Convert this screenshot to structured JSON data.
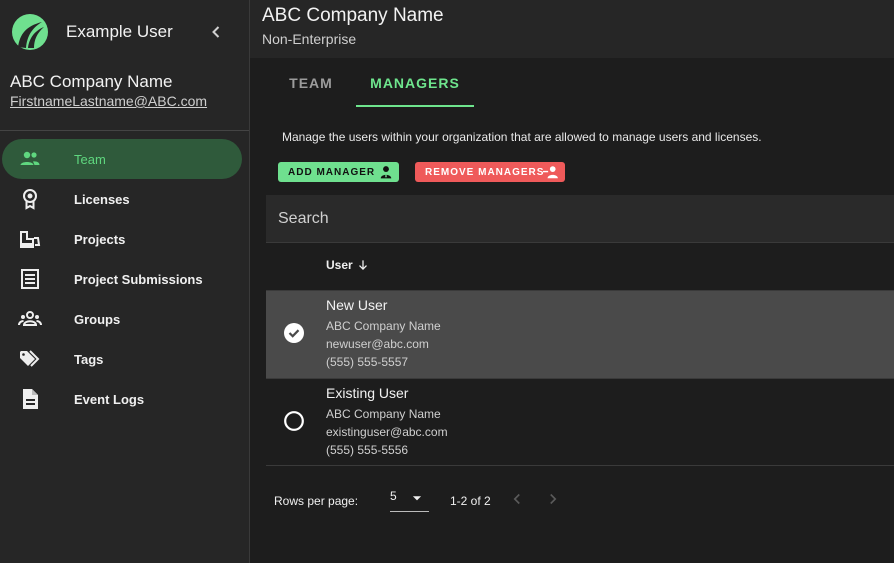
{
  "sidebar": {
    "user_name": "Example User",
    "company": "ABC Company Name",
    "email": "FirstnameLastname@ABC.com",
    "items": [
      {
        "label": "Team",
        "icon": "people-icon",
        "active": true
      },
      {
        "label": "Licenses",
        "icon": "license-badge-icon"
      },
      {
        "label": "Projects",
        "icon": "bulldozer-icon"
      },
      {
        "label": "Project Submissions",
        "icon": "document-list-icon"
      },
      {
        "label": "Groups",
        "icon": "groups-icon"
      },
      {
        "label": "Tags",
        "icon": "tags-icon"
      },
      {
        "label": "Event Logs",
        "icon": "file-icon"
      }
    ]
  },
  "header": {
    "title": "ABC Company Name",
    "subtitle": "Non-Enterprise"
  },
  "tabs": [
    {
      "label": "TEAM"
    },
    {
      "label": "MANAGERS",
      "active": true
    }
  ],
  "description": "Manage the users within your organization that are allowed to manage users and licenses.",
  "buttons": {
    "add": "ADD MANAGER",
    "remove": "REMOVE MANAGERS"
  },
  "search": {
    "placeholder": "Search"
  },
  "table": {
    "column": "User",
    "rows": [
      {
        "name": "New User",
        "company": "ABC Company Name",
        "email": "newuser@abc.com",
        "phone": "(555) 555-5557",
        "selected": true
      },
      {
        "name": "Existing User",
        "company": "ABC Company Name",
        "email": "existinguser@abc.com",
        "phone": "(555) 555-5556",
        "selected": false
      }
    ]
  },
  "pagination": {
    "rows_label": "Rows per page:",
    "rows_value": "5",
    "range": "1-2 of 2"
  },
  "colors": {
    "accent_green": "#6ee58d",
    "remove_red": "#ef5a5a",
    "selected_row": "#4a4a4a"
  }
}
